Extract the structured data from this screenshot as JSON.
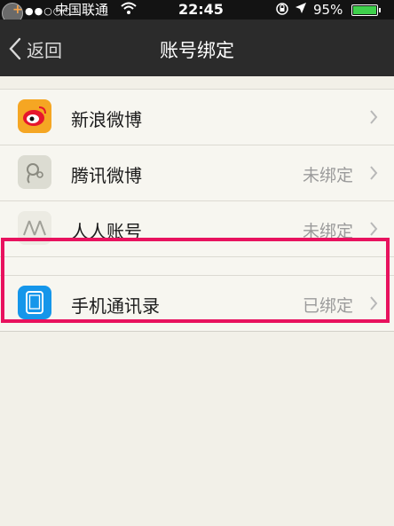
{
  "status_bar": {
    "signal_dots": "●●○○○",
    "carrier": "中国联通",
    "time": "22:45",
    "battery_percent": "95%"
  },
  "navbar": {
    "back_label": "返回",
    "title": "账号绑定"
  },
  "accounts": [
    {
      "label": "新浪微博",
      "status": "",
      "icon": "weibo-icon"
    },
    {
      "label": "腾讯微博",
      "status": "未绑定",
      "icon": "tencent-weibo-icon"
    },
    {
      "label": "人人账号",
      "status": "未绑定",
      "icon": "renren-icon"
    },
    {
      "label": "手机通讯录",
      "status": "已绑定",
      "icon": "phone-contacts-icon"
    }
  ],
  "colors": {
    "highlight": "#e8125e",
    "battery": "#3ed04b",
    "navbar": "#2b2b2b"
  }
}
